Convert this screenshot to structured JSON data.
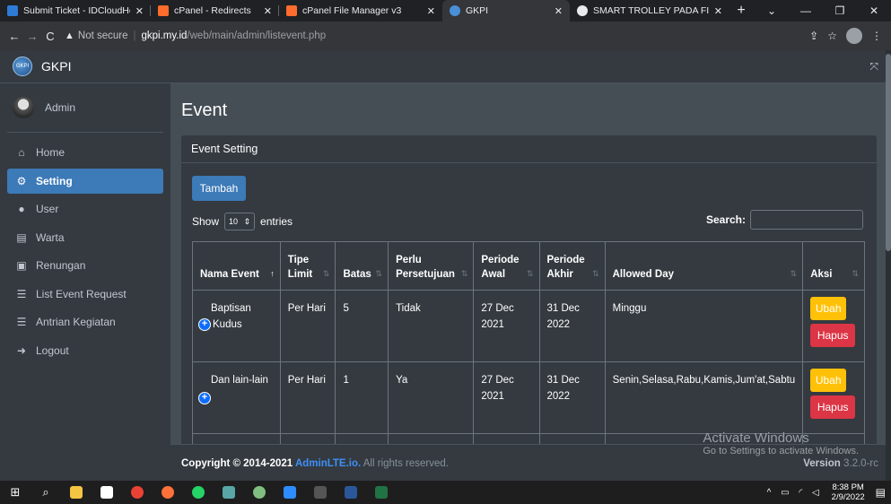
{
  "browser": {
    "tabs": [
      {
        "title": "Submit Ticket - IDCloudHost",
        "fav": "#2d7bd6"
      },
      {
        "title": "cPanel - Redirects",
        "fav": "#ff6c2c"
      },
      {
        "title": "cPanel File Manager v3",
        "fav": "#ff6c2c"
      },
      {
        "title": "GKPI",
        "fav": "#4a90d9"
      },
      {
        "title": "SMART TROLLEY PADA FITRI",
        "fav": "#e8eaed"
      }
    ],
    "security": "Not secure",
    "host": "gkpi.my.id",
    "path": "/web/main/admin/listevent.php"
  },
  "sidebar": {
    "brand": "GKPI",
    "user": "Admin",
    "items": [
      {
        "label": "Home",
        "icon": "⌂"
      },
      {
        "label": "Setting",
        "icon": "⚙"
      },
      {
        "label": "User",
        "icon": "●"
      },
      {
        "label": "Warta",
        "icon": "▤"
      },
      {
        "label": "Renungan",
        "icon": "▣"
      },
      {
        "label": "List Event Request",
        "icon": "☰"
      },
      {
        "label": "Antrian Kegiatan",
        "icon": "☰"
      },
      {
        "label": "Logout",
        "icon": "➜"
      }
    ]
  },
  "page": {
    "title": "Event",
    "card_title": "Event Setting",
    "add_button": "Tambah",
    "show_label": "Show",
    "entries_value": "10",
    "entries_label": "entries",
    "search_label": "Search:"
  },
  "table": {
    "headers": [
      {
        "line1": "Nama Event",
        "line2": "",
        "sort": "↑"
      },
      {
        "line1": "Tipe",
        "line2": "Limit",
        "sort": "⇅"
      },
      {
        "line1": "",
        "line2": "Batas",
        "sort": "⇅"
      },
      {
        "line1": "Perlu",
        "line2": "Persetujuan",
        "sort": "⇅"
      },
      {
        "line1": "Periode",
        "line2": "Awal",
        "sort": "⇅"
      },
      {
        "line1": "Periode",
        "line2": "Akhir",
        "sort": "⇅"
      },
      {
        "line1": "",
        "line2": "Allowed Day",
        "sort": "⇅"
      },
      {
        "line1": "",
        "line2": "Aksi",
        "sort": "⇅"
      }
    ],
    "rows": [
      {
        "name1": "Baptisan",
        "name2": "Kudus",
        "tipe": "Per Hari",
        "batas": "5",
        "perlu": "Tidak",
        "awal1": "27 Dec",
        "awal2": "2021",
        "akhir1": "31 Dec",
        "akhir2": "2022",
        "days": "Minggu",
        "edit": "Ubah",
        "del": "Hapus"
      },
      {
        "name1": "Dan lain-lain",
        "name2": "",
        "tipe": "Per Hari",
        "batas": "1",
        "perlu": "Ya",
        "awal1": "27 Dec",
        "awal2": "2021",
        "akhir1": "31 Dec",
        "akhir2": "2022",
        "days": "Senin,Selasa,Rabu,Kamis,Jum'at,Sabtu",
        "edit": "Ubah",
        "del": "Hapus"
      }
    ]
  },
  "footer": {
    "copy_prefix": "Copyright © 2014-2021 ",
    "copy_link": "AdminLTE.io.",
    "copy_suffix": " All rights reserved.",
    "version_label": "Version",
    "version_value": "3.2.0-rc"
  },
  "watermark": {
    "line1": "Activate Windows",
    "line2": "Go to Settings to activate Windows."
  },
  "taskbar": {
    "time": "8:38 PM",
    "date": "2/9/2022"
  }
}
